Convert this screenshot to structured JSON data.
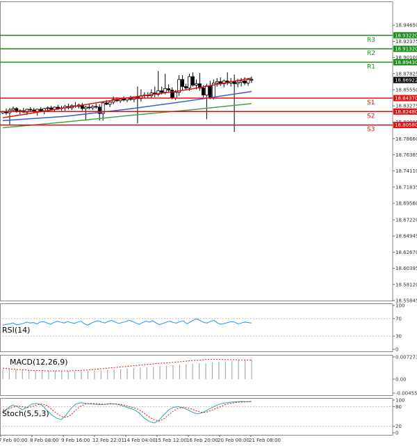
{
  "chart_data": [
    {
      "type": "candlestick",
      "ylim": [
        18.55845,
        18.98
      ],
      "y_ticks": [
        "18.94650",
        "18.92375",
        "18.90100",
        "18.87825",
        "18.85550",
        "18.83275",
        "18.80995",
        "18.78660",
        "18.76385",
        "18.74110",
        "18.71835",
        "18.69560",
        "18.67220",
        "18.64945",
        "18.62670",
        "18.60395",
        "18.58120",
        "18.55845"
      ],
      "x_ticks": [
        "7 Feb 00:00",
        "8 Feb 08:00",
        "9 Feb 16:00",
        "12 Feb 22:01",
        "14 Feb 04:00",
        "15 Feb 12:00",
        "16 Feb 20:00",
        "20 Feb 00:00",
        "21 Feb 08:00"
      ],
      "current_price": 18.86922,
      "levels": [
        {
          "label": "R3",
          "price": 18.9322,
          "price_label": "18.93220",
          "color": "#1a8f1a"
        },
        {
          "label": "R2",
          "price": 18.9132,
          "price_label": "18.91320",
          "color": "#1a8f1a"
        },
        {
          "label": "R1",
          "price": 18.8943,
          "price_label": "18.89430",
          "color": "#1a8f1a"
        },
        {
          "label": "S1",
          "price": 18.8437,
          "price_label": "18.84370",
          "color": "#e01010"
        },
        {
          "label": "S2",
          "price": 18.8248,
          "price_label": "18.82480",
          "color": "#e01010"
        },
        {
          "label": "S3",
          "price": 18.8058,
          "price_label": "18.80580",
          "color": "#e01010"
        }
      ],
      "candles": [
        [
          18.823,
          18.826,
          18.821,
          18.825
        ],
        [
          18.825,
          18.829,
          18.82,
          18.823
        ],
        [
          18.823,
          18.83,
          18.805,
          18.827
        ],
        [
          18.827,
          18.832,
          18.824,
          18.829
        ],
        [
          18.829,
          18.831,
          18.823,
          18.825
        ],
        [
          18.825,
          18.828,
          18.821,
          18.826
        ],
        [
          18.826,
          18.83,
          18.823,
          18.824
        ],
        [
          18.824,
          18.829,
          18.82,
          18.828
        ],
        [
          18.828,
          18.831,
          18.825,
          18.827
        ],
        [
          18.827,
          18.83,
          18.822,
          18.825
        ],
        [
          18.825,
          18.829,
          18.819,
          18.828
        ],
        [
          18.828,
          18.831,
          18.824,
          18.826
        ],
        [
          18.826,
          18.83,
          18.821,
          18.829
        ],
        [
          18.829,
          18.832,
          18.826,
          18.83
        ],
        [
          18.83,
          18.833,
          18.827,
          18.828
        ],
        [
          18.828,
          18.832,
          18.825,
          18.831
        ],
        [
          18.831,
          18.834,
          18.827,
          18.829
        ],
        [
          18.829,
          18.833,
          18.826,
          18.83
        ],
        [
          18.83,
          18.834,
          18.826,
          18.832
        ],
        [
          18.832,
          18.836,
          18.828,
          18.83
        ],
        [
          18.83,
          18.835,
          18.827,
          18.833
        ],
        [
          18.833,
          18.838,
          18.83,
          18.832
        ],
        [
          18.832,
          18.836,
          18.829,
          18.834
        ],
        [
          18.834,
          18.837,
          18.826,
          18.829
        ],
        [
          18.829,
          18.833,
          18.812,
          18.831
        ],
        [
          18.831,
          18.835,
          18.828,
          18.83
        ],
        [
          18.83,
          18.834,
          18.827,
          18.832
        ],
        [
          18.832,
          18.836,
          18.829,
          18.831
        ],
        [
          18.831,
          18.835,
          18.812,
          18.822
        ],
        [
          18.822,
          18.838,
          18.812,
          18.837
        ],
        [
          18.837,
          18.841,
          18.834,
          18.835
        ],
        [
          18.835,
          18.84,
          18.831,
          18.838
        ],
        [
          18.838,
          18.846,
          18.835,
          18.842
        ],
        [
          18.842,
          18.845,
          18.838,
          18.84
        ],
        [
          18.84,
          18.844,
          18.837,
          18.843
        ],
        [
          18.843,
          18.846,
          18.839,
          18.841
        ],
        [
          18.841,
          18.845,
          18.838,
          18.844
        ],
        [
          18.844,
          18.847,
          18.84,
          18.842
        ],
        [
          18.842,
          18.846,
          18.838,
          18.845
        ],
        [
          18.845,
          18.86,
          18.808,
          18.843
        ],
        [
          18.843,
          18.856,
          18.839,
          18.847
        ],
        [
          18.847,
          18.852,
          18.843,
          18.848
        ],
        [
          18.848,
          18.852,
          18.844,
          18.847
        ],
        [
          18.847,
          18.856,
          18.844,
          18.851
        ],
        [
          18.851,
          18.86,
          18.845,
          18.849
        ],
        [
          18.849,
          18.882,
          18.846,
          18.854
        ],
        [
          18.854,
          18.86,
          18.849,
          18.852
        ],
        [
          18.852,
          18.878,
          18.849,
          18.857
        ],
        [
          18.857,
          18.863,
          18.851,
          18.855
        ],
        [
          18.855,
          18.859,
          18.842,
          18.844
        ],
        [
          18.844,
          18.855,
          18.841,
          18.852
        ],
        [
          18.852,
          18.876,
          18.847,
          18.87
        ],
        [
          18.87,
          18.876,
          18.855,
          18.86
        ],
        [
          18.86,
          18.864,
          18.855,
          18.858
        ],
        [
          18.858,
          18.878,
          18.854,
          18.874
        ],
        [
          18.874,
          18.88,
          18.86,
          18.862
        ],
        [
          18.862,
          18.87,
          18.856,
          18.864
        ],
        [
          18.864,
          18.879,
          18.854,
          18.858
        ],
        [
          18.858,
          18.862,
          18.845,
          18.848
        ],
        [
          18.848,
          18.864,
          18.814,
          18.861
        ],
        [
          18.861,
          18.868,
          18.842,
          18.845
        ],
        [
          18.845,
          18.87,
          18.842,
          18.865
        ],
        [
          18.865,
          18.872,
          18.86,
          18.867
        ],
        [
          18.867,
          18.873,
          18.861,
          18.864
        ],
        [
          18.864,
          18.87,
          18.859,
          18.868
        ],
        [
          18.868,
          18.88,
          18.862,
          18.865
        ],
        [
          18.865,
          18.872,
          18.86,
          18.867
        ],
        [
          18.867,
          18.877,
          18.796,
          18.864
        ],
        [
          18.864,
          18.871,
          18.859,
          18.866
        ],
        [
          18.866,
          18.872,
          18.86,
          18.868
        ],
        [
          18.868,
          18.873,
          18.862,
          18.865
        ],
        [
          18.865,
          18.872,
          18.861,
          18.87
        ],
        [
          18.87,
          18.874,
          18.865,
          18.8692
        ]
      ],
      "ma_red": [
        18.816,
        18.83,
        18.844,
        18.856,
        18.872
      ],
      "ma_blue": [
        18.812,
        18.818,
        18.828,
        18.84,
        18.853
      ],
      "ma_green": [
        18.802,
        18.81,
        18.819,
        18.827,
        18.836
      ]
    },
    {
      "type": "line",
      "label": "RSI(14)",
      "ylim": [
        0,
        100
      ],
      "y_ticks": [
        100,
        70,
        30,
        0
      ],
      "values": [
        55,
        57,
        58,
        60,
        56,
        57,
        59,
        62,
        60,
        61,
        58,
        62,
        63,
        60,
        57,
        61,
        64,
        62,
        60,
        63,
        61,
        59,
        62,
        64,
        58,
        55,
        60,
        63,
        65,
        62,
        60,
        64,
        66,
        62,
        59,
        61,
        63,
        66,
        64,
        60,
        57,
        61,
        64,
        62,
        65,
        60,
        56,
        59,
        62,
        64,
        61,
        60,
        63,
        65,
        58,
        62,
        67,
        69,
        65,
        61,
        60,
        64,
        66,
        60,
        57,
        59,
        61,
        63,
        62,
        58,
        60,
        62,
        61,
        60
      ]
    },
    {
      "type": "bar",
      "label": "MACD(12,26,9)",
      "ylim": [
        -0.004557,
        0.007273
      ],
      "y_ticks": [
        "0.007273",
        "0.00",
        "-0.004557"
      ],
      "histogram": [
        0.0032,
        0.0034,
        0.0031,
        0.0029,
        0.003,
        0.0028,
        0.0027,
        0.0029,
        0.0028,
        0.0026,
        0.0027,
        0.0025,
        0.0026,
        0.0027,
        0.0028,
        0.0029,
        0.003,
        0.0032,
        0.0033,
        0.0035,
        0.0036,
        0.0038,
        0.0039,
        0.004,
        0.0042,
        0.0044,
        0.0046,
        0.0047,
        0.0049,
        0.005,
        0.0052,
        0.0053,
        0.0055,
        0.0057,
        0.0058,
        0.006,
        0.0062,
        0.0064,
        0.0065
      ],
      "signal": [
        0.0036,
        0.0034,
        0.0032,
        0.0031,
        0.0029,
        0.0028,
        0.0028,
        0.0027,
        0.0027,
        0.0027,
        0.0027,
        0.0028,
        0.0029,
        0.003,
        0.0032,
        0.0034,
        0.0036,
        0.0038,
        0.004,
        0.0042,
        0.0044,
        0.0046,
        0.0048,
        0.005,
        0.0052,
        0.0053,
        0.0055,
        0.0057,
        0.0059,
        0.0061,
        0.0062,
        0.0064,
        0.0065,
        0.0065,
        0.0064,
        0.0064,
        0.0063,
        0.0063,
        0.0062
      ]
    },
    {
      "type": "line",
      "label": "Stoch(5,5,3)",
      "ylim": [
        0,
        100
      ],
      "y_ticks": [
        100,
        80,
        20,
        0
      ],
      "k_line": [
        60,
        75,
        85,
        80,
        70,
        78,
        88,
        90,
        85,
        70,
        55,
        45,
        40,
        55,
        75,
        88,
        92,
        90,
        88,
        87,
        86,
        87,
        89,
        88,
        85,
        80,
        75,
        70,
        60,
        45,
        35,
        30,
        38,
        55,
        70,
        78,
        80,
        76,
        70,
        62,
        58,
        62,
        70,
        78,
        85,
        90,
        92,
        94,
        95,
        96,
        95,
        96
      ],
      "d_line": [
        70,
        72,
        78,
        82,
        80,
        77,
        80,
        85,
        88,
        84,
        72,
        60,
        50,
        47,
        55,
        70,
        82,
        88,
        90,
        89,
        88,
        87,
        88,
        88,
        87,
        84,
        80,
        76,
        70,
        60,
        48,
        40,
        36,
        42,
        55,
        67,
        75,
        78,
        76,
        71,
        65,
        62,
        64,
        70,
        76,
        82,
        88,
        91,
        93,
        94,
        95,
        95
      ]
    }
  ]
}
